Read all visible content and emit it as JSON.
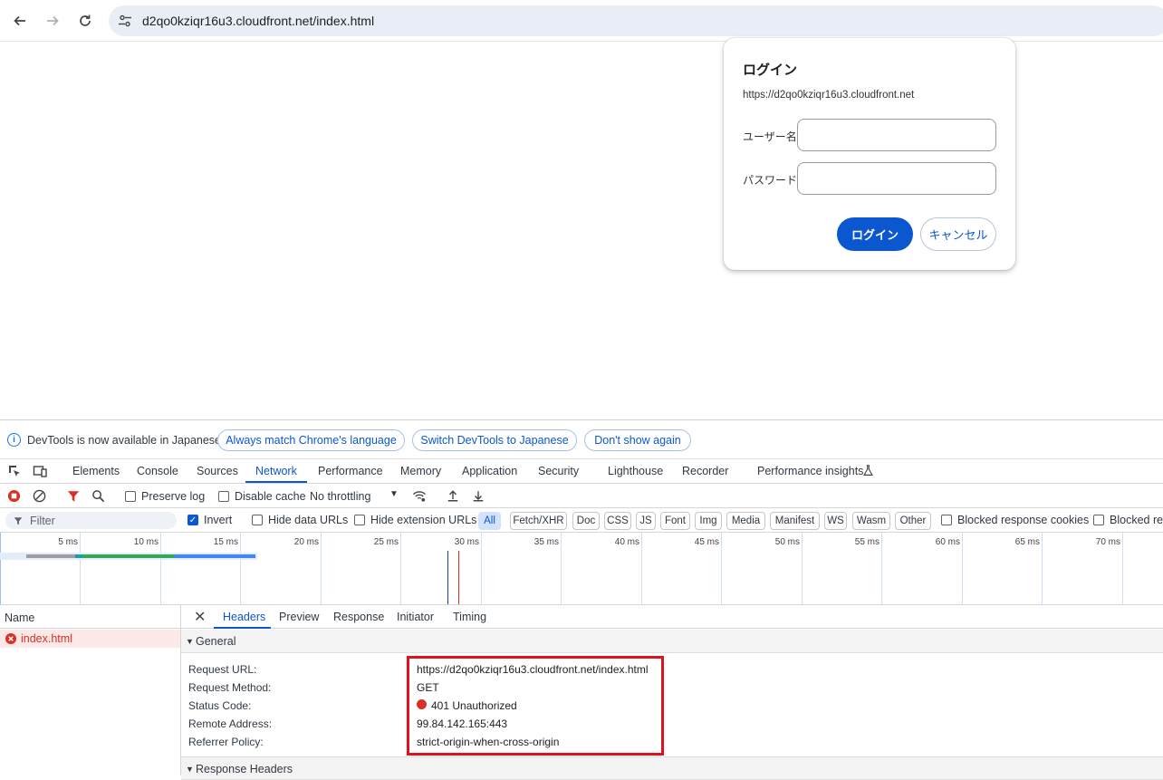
{
  "browser": {
    "url": "d2qo0kziqr16u3.cloudfront.net/index.html",
    "back_icon": "arrow-left-icon",
    "forward_icon": "arrow-right-icon",
    "reload_icon": "reload-icon"
  },
  "auth_dialog": {
    "title": "ログイン",
    "origin": "https://d2qo0kziqr16u3.cloudfront.net",
    "username_label": "ユーザー名",
    "password_label": "パスワード",
    "username_value": "",
    "password_value": "",
    "login_button": "ログイン",
    "cancel_button": "キャンセル",
    "accent_color": "#0b57d0"
  },
  "devtools": {
    "infobar": {
      "message": "DevTools is now available in Japanese!",
      "always_match": "Always match Chrome's language",
      "switch": "Switch DevTools to Japanese",
      "dont_show": "Don't show again"
    },
    "tabs": [
      "Elements",
      "Console",
      "Sources",
      "Network",
      "Performance",
      "Memory",
      "Application",
      "Security",
      "Lighthouse",
      "Recorder",
      "Performance insights"
    ],
    "active_tab": "Network",
    "network_toolbar": {
      "preserve_log": "Preserve log",
      "disable_cache": "Disable cache",
      "throttling": "No throttling"
    },
    "filter_bar": {
      "placeholder": "Filter",
      "invert": "Invert",
      "invert_checked": true,
      "hide_data_urls": "Hide data URLs",
      "hide_extension_urls": "Hide extension URLs",
      "types": [
        "All",
        "Fetch/XHR",
        "Doc",
        "CSS",
        "JS",
        "Font",
        "Img",
        "Media",
        "Manifest",
        "WS",
        "Wasm",
        "Other"
      ],
      "active_type": "All",
      "blocked_response_cookies": "Blocked response cookies",
      "blocked_requests": "Blocked rec"
    },
    "timeline": {
      "ticks": [
        "5 ms",
        "10 ms",
        "15 ms",
        "20 ms",
        "25 ms",
        "30 ms",
        "35 ms",
        "40 ms",
        "45 ms",
        "50 ms",
        "55 ms",
        "60 ms",
        "65 ms",
        "70 ms"
      ]
    },
    "request_list": {
      "header": "Name",
      "requests": [
        {
          "name": "index.html",
          "status": "error"
        }
      ]
    },
    "details": {
      "tabs": [
        "Headers",
        "Preview",
        "Response",
        "Initiator",
        "Timing"
      ],
      "active_tab": "Headers",
      "general_title": "General",
      "general": [
        {
          "key": "Request URL:",
          "value": "https://d2qo0kziqr16u3.cloudfront.net/index.html"
        },
        {
          "key": "Request Method:",
          "value": "GET"
        },
        {
          "key": "Status Code:",
          "value": "401 Unauthorized"
        },
        {
          "key": "Remote Address:",
          "value": "99.84.142.165:443"
        },
        {
          "key": "Referrer Policy:",
          "value": "strict-origin-when-cross-origin"
        }
      ],
      "response_headers_title": "Response Headers",
      "error_color": "#d93025",
      "highlight_color": "#e0111b"
    }
  }
}
